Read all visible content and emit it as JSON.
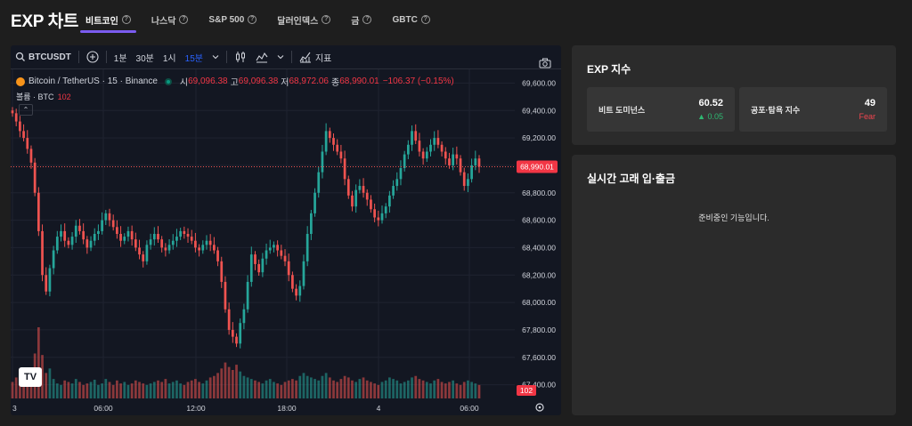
{
  "header": {
    "title": "EXP 차트",
    "tabs": [
      {
        "label": "비트코인",
        "active": true
      },
      {
        "label": "나스닥",
        "active": false
      },
      {
        "label": "S&P 500",
        "active": false
      },
      {
        "label": "달러인덱스",
        "active": false
      },
      {
        "label": "금",
        "active": false
      },
      {
        "label": "GBTC",
        "active": false
      }
    ],
    "help_glyph": "?"
  },
  "chart": {
    "toolbar": {
      "symbol": "BTCUSDT",
      "intervals": [
        "1분",
        "30분",
        "1시",
        "15분"
      ],
      "active_interval": "15분",
      "indicators_label": "지표"
    },
    "legend": {
      "symbol_name": "Bitcoin / TetherUS · 15 · Binance",
      "open_label": "시",
      "open": "69,096.38",
      "high_label": "고",
      "high": "69,096.38",
      "low_label": "저",
      "low": "68,972.06",
      "close_label": "종",
      "close": "68,990.01",
      "change": "−106.37 (−0.15%)"
    },
    "volume_legend": {
      "label": "볼륨 · BTC",
      "value": "102"
    },
    "collapse_glyph": "⌃",
    "logo_text": "TV",
    "colors": {
      "up": "#26a69a",
      "down": "#ef5350",
      "background": "#131722",
      "grid": "#1f2330",
      "text": "#d1d4dc"
    },
    "chart_data": {
      "type": "candlestick",
      "symbol": "BTCUSDT",
      "interval": "15분",
      "ylim": [
        67300,
        69700
      ],
      "y_ticks": [
        "69,600.00",
        "69,400.00",
        "69,200.00",
        "69,000.00",
        "68,800.00",
        "68,600.00",
        "68,400.00",
        "68,200.00",
        "68,000.00",
        "67,800.00",
        "67,600.00",
        "67,400.00"
      ],
      "x_ticks": [
        "3",
        "06:00",
        "12:00",
        "18:00",
        "4",
        "06:00"
      ],
      "last_price_label": "68,990.01",
      "last_volume_label": "102",
      "close_path": [
        69380,
        69320,
        69250,
        69200,
        69120,
        69020,
        68800,
        68520,
        68200,
        68080,
        68250,
        68380,
        68480,
        68520,
        68450,
        68420,
        68480,
        68560,
        68520,
        68460,
        68400,
        68450,
        68500,
        68520,
        68600,
        68650,
        68600,
        68550,
        68500,
        68450,
        68480,
        68520,
        68460,
        68400,
        68350,
        68300,
        68420,
        68460,
        68500,
        68460,
        68400,
        68380,
        68420,
        68450,
        68480,
        68520,
        68500,
        68480,
        68450,
        68400,
        68380,
        68420,
        68450,
        68420,
        68380,
        68300,
        68150,
        67950,
        67800,
        67750,
        67700,
        67850,
        67950,
        68150,
        68350,
        68280,
        68220,
        68320,
        68380,
        68400,
        68420,
        68380,
        68340,
        68300,
        68200,
        68100,
        68050,
        68120,
        68300,
        68500,
        68650,
        68800,
        68950,
        69100,
        69250,
        69200,
        69150,
        69100,
        69050,
        68900,
        68780,
        68700,
        68820,
        68850,
        68800,
        68750,
        68680,
        68620,
        68600,
        68650,
        68700,
        68780,
        68850,
        68900,
        68980,
        69080,
        69150,
        69250,
        69180,
        69100,
        69050,
        69100,
        69150,
        69200,
        69150,
        69100,
        69050,
        69000,
        69080,
        69050,
        68950,
        68850,
        68900,
        69000,
        69050,
        68990
      ],
      "volume_path": [
        22,
        28,
        30,
        20,
        24,
        32,
        60,
        95,
        58,
        34,
        40,
        26,
        20,
        18,
        24,
        22,
        20,
        26,
        22,
        18,
        20,
        22,
        25,
        18,
        20,
        26,
        22,
        18,
        24,
        20,
        22,
        18,
        20,
        24,
        22,
        20,
        18,
        20,
        22,
        24,
        22,
        26,
        20,
        22,
        24,
        20,
        18,
        22,
        24,
        26,
        22,
        20,
        24,
        28,
        30,
        34,
        40,
        48,
        42,
        38,
        45,
        36,
        30,
        28,
        26,
        24,
        22,
        20,
        24,
        26,
        22,
        20,
        18,
        22,
        24,
        26,
        24,
        30,
        34,
        30,
        28,
        26,
        24,
        30,
        34,
        28,
        24,
        22,
        26,
        30,
        28,
        24,
        22,
        26,
        28,
        24,
        22,
        20,
        18,
        22,
        24,
        28,
        26,
        24,
        20,
        22,
        24,
        28,
        30,
        26,
        24,
        22,
        20,
        24,
        26,
        22,
        20,
        22,
        24,
        20,
        18,
        22,
        24,
        22,
        20,
        18
      ]
    }
  },
  "exp_index": {
    "title": "EXP 지수",
    "dominance": {
      "label": "비트 도미넌스",
      "value": "60.52",
      "change": "▲ 0.05"
    },
    "fear_greed": {
      "label": "공포·탐욕 지수",
      "value": "49",
      "status": "Fear"
    }
  },
  "whale": {
    "title": "실시간 고래 입·출금",
    "message": "준비중인 기능입니다."
  }
}
